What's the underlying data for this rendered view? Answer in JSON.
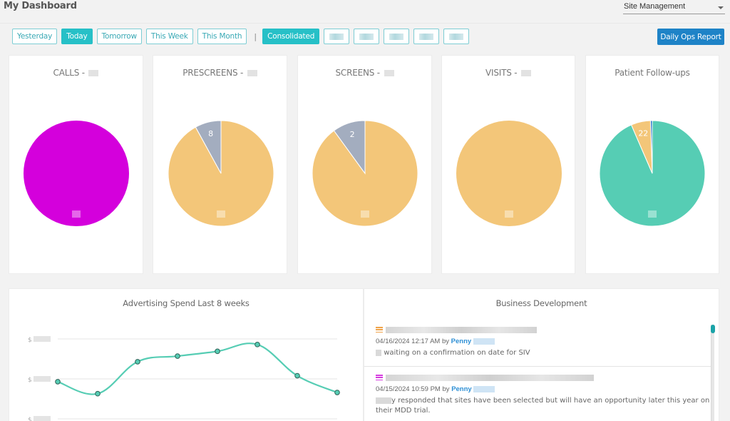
{
  "header": {
    "title": "My Dashboard",
    "site_select": {
      "selected": "Site Management"
    }
  },
  "toolbar": {
    "range_buttons": [
      {
        "label": "Yesterday",
        "active": false
      },
      {
        "label": "Today",
        "active": true
      },
      {
        "label": "Tomorrow",
        "active": false
      },
      {
        "label": "This Week",
        "active": false
      },
      {
        "label": "This Month",
        "active": false
      }
    ],
    "separator": "|",
    "consolidated_label": "Consolidated",
    "site_buttons_count": 5,
    "report_button": "Daily Ops Report"
  },
  "colors": {
    "accent": "#26c0c7",
    "report_blue": "#1e83c7",
    "magenta": "#d400dc",
    "orange": "#f3c679",
    "gray": "#a3adbf",
    "teal": "#56cdb4",
    "blue": "#1e6fc7",
    "line": "#56cdb4"
  },
  "chart_data": [
    {
      "type": "pie",
      "title": "CALLS - ",
      "slices": [
        {
          "label": "",
          "value": 100,
          "color": "#d400dc",
          "shown_label": ""
        }
      ]
    },
    {
      "type": "pie",
      "title": "PRESCREENS - ",
      "slices": [
        {
          "label": "",
          "value": 92,
          "color": "#f3c679",
          "shown_label": ""
        },
        {
          "label": "",
          "value": 8,
          "color": "#a3adbf",
          "shown_label": "8"
        }
      ]
    },
    {
      "type": "pie",
      "title": "SCREENS - ",
      "slices": [
        {
          "label": "",
          "value": 18,
          "color": "#f3c679",
          "shown_label": ""
        },
        {
          "label": "",
          "value": 2,
          "color": "#a3adbf",
          "shown_label": "2"
        }
      ]
    },
    {
      "type": "pie",
      "title": "VISITS - ",
      "slices": [
        {
          "label": "",
          "value": 100,
          "color": "#f3c679",
          "shown_label": ""
        }
      ]
    },
    {
      "type": "pie",
      "title": "Patient Follow-ups",
      "slices": [
        {
          "label": "",
          "value": 345,
          "color": "#56cdb4",
          "shown_label": ""
        },
        {
          "label": "",
          "value": 22,
          "color": "#f3c679",
          "shown_label": "22"
        },
        {
          "label": "",
          "value": 2,
          "color": "#1e6fc7",
          "shown_label": ""
        }
      ]
    },
    {
      "type": "line",
      "title": "Advertising Spend Last 8 weeks",
      "ytick_labels": [
        "$",
        "$",
        "$"
      ],
      "ylim": [
        0,
        2
      ],
      "grid": true,
      "x": [
        1,
        2,
        3,
        4,
        5,
        6,
        7,
        8
      ],
      "values": [
        0.93,
        0.63,
        1.43,
        1.57,
        1.69,
        1.86,
        1.08,
        0.66
      ]
    }
  ],
  "business_development": {
    "title": "Business Development",
    "items": [
      {
        "icon_color": "#f0a34a",
        "timestamp": "04/16/2024 12:17 AM",
        "by": "by",
        "author": "Penny",
        "note": "waiting on a confirmation on date for SIV"
      },
      {
        "icon_color": "#d63be0",
        "timestamp": "04/15/2024 10:59 PM",
        "by": "by",
        "author": "Penny",
        "note": "y responded that sites have been selected but will have an opportunity later this year on their MDD trial."
      }
    ]
  }
}
